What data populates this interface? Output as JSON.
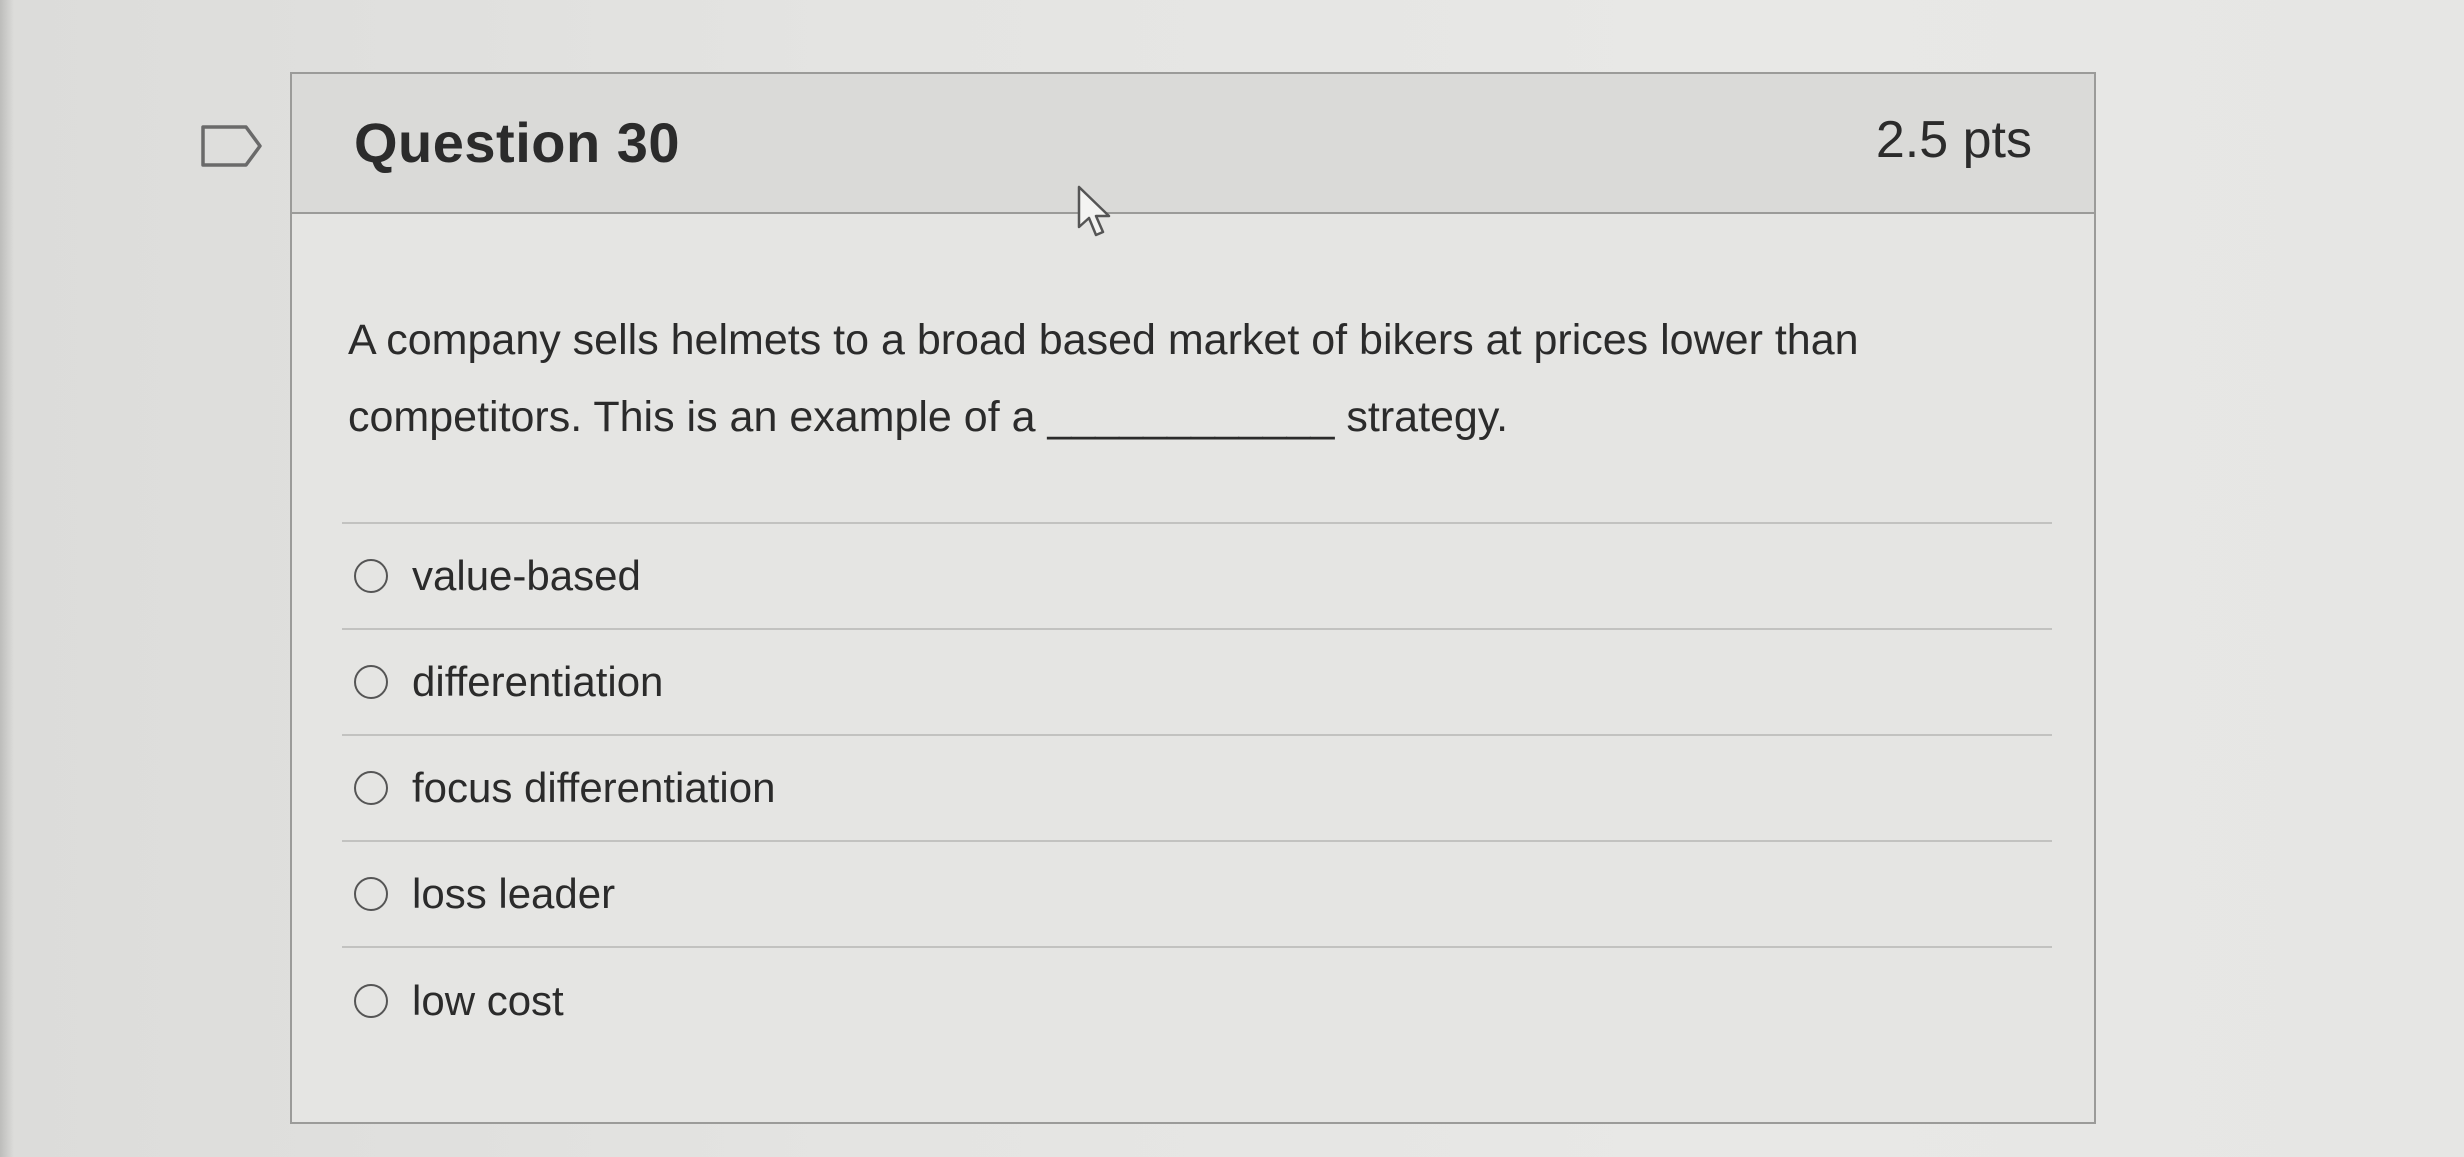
{
  "question": {
    "title": "Question 30",
    "points": "2.5 pts",
    "text": "A company sells helmets to a broad based market of bikers at prices lower than competitors. This is an example of a ____________ strategy.",
    "answers": [
      {
        "label": "value-based",
        "selected": false
      },
      {
        "label": "differentiation",
        "selected": false
      },
      {
        "label": "focus differentiation",
        "selected": false
      },
      {
        "label": "loss leader",
        "selected": false
      },
      {
        "label": "low cost",
        "selected": false
      }
    ]
  },
  "icons": {
    "flag": "flag-question-icon",
    "cursor": "mouse-pointer-icon",
    "radio": "radio-button-icon"
  }
}
